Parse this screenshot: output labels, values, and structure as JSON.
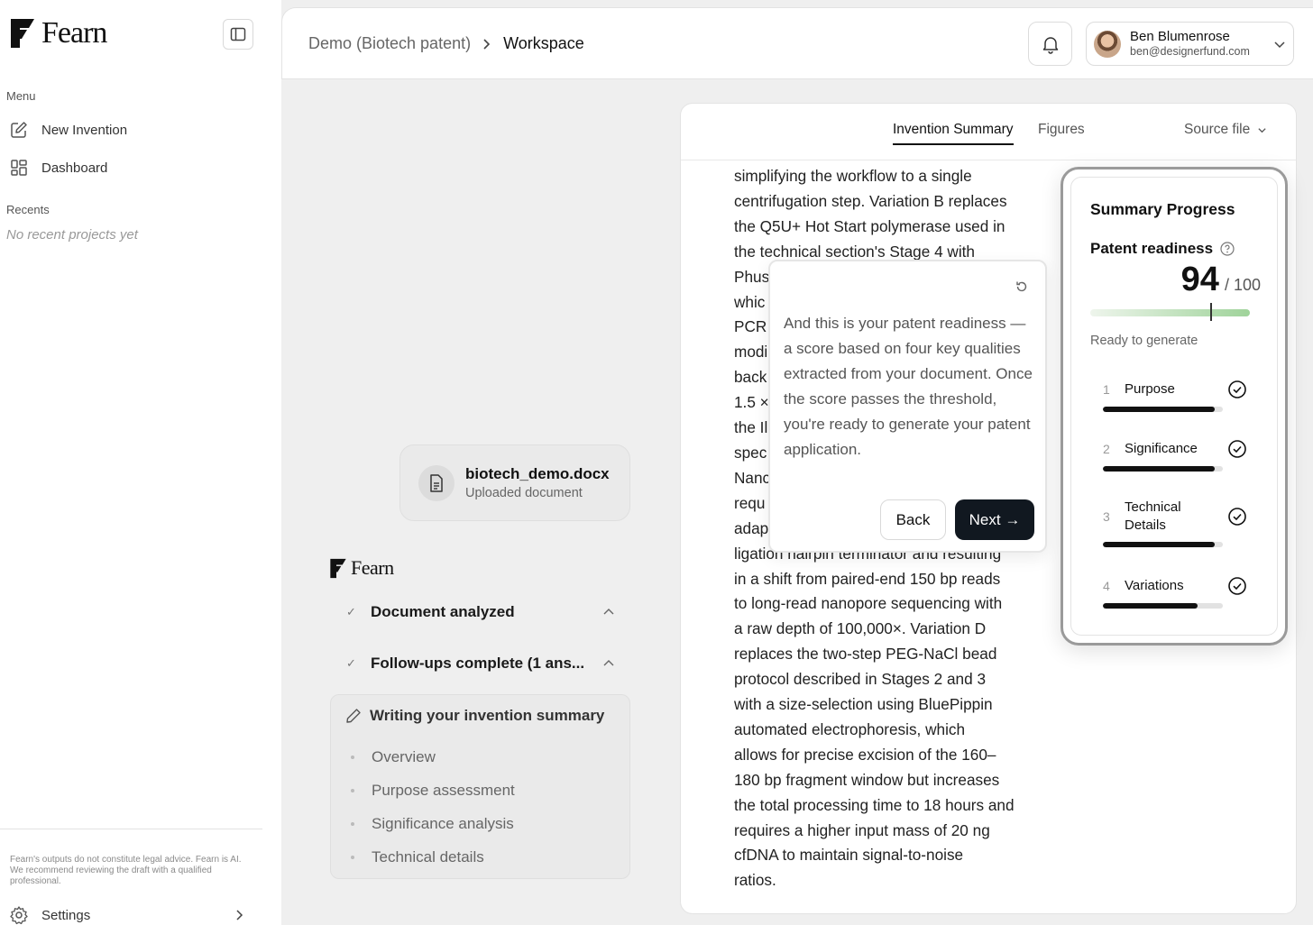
{
  "app": {
    "brand": "Fearn"
  },
  "sidebar": {
    "menu_label": "Menu",
    "items": [
      {
        "label": "New Invention",
        "icon": "edit-icon"
      },
      {
        "label": "Dashboard",
        "icon": "grid-icon"
      }
    ],
    "recents_label": "Recents",
    "recents_empty": "No recent projects yet",
    "disclaimer": "Fearn's outputs do not constitute legal advice. Fearn is AI. We recommend reviewing the draft with a qualified professional.",
    "settings_label": "Settings"
  },
  "header": {
    "breadcrumb": [
      "Demo (Biotech patent)",
      "Workspace"
    ],
    "user": {
      "name": "Ben Blumenrose",
      "email": "ben@designerfund.com"
    }
  },
  "upload": {
    "file_name": "biotech_demo.docx",
    "file_sub": "Uploaded document"
  },
  "steps": {
    "analyzed": "Document analyzed",
    "followups": "Follow-ups complete (1 ans...",
    "writing": "Writing your invention summary",
    "sub_steps": [
      "Overview",
      "Purpose assessment",
      "Significance analysis",
      "Technical details"
    ]
  },
  "doc": {
    "tabs": [
      "Invention Summary",
      "Figures"
    ],
    "source_file": "Source file",
    "lines": [
      "simplifying the workflow to a single",
      "centrifugation step. Variation B replaces",
      "the Q5U+ Hot Start polymerase used in",
      "the technical section's Stage 4 with",
      "Phus",
      "whic",
      "PCR",
      "modi",
      "back",
      "1.5 ×",
      "the Il",
      "spec",
      "Nanc",
      "requ",
      "adap",
      "ligation hairpin terminator and resulting",
      "in a shift from paired-end 150 bp reads",
      "to long-read nanopore sequencing with",
      "a raw depth of 100,000×. Variation D",
      "replaces the two-step PEG-NaCl bead",
      "protocol described in Stages 2 and 3",
      "with a size-selection using BluePippin",
      "automated electrophoresis, which",
      "allows for precise excision of the 160–",
      "180 bp fragment window but increases",
      "the total processing time to 18 hours and",
      "requires a higher input mass of 20 ng",
      "cfDNA to maintain signal-to-noise",
      "ratios."
    ]
  },
  "tour": {
    "text": "And this is your patent readiness — a score based on four key qualities extracted from your document. Once the score passes the threshold, you're ready to generate your patent application.",
    "back": "Back",
    "next": "Next →"
  },
  "progress": {
    "title": "Summary Progress",
    "readiness_label": "Patent readiness",
    "score": "94",
    "score_max": "/ 100",
    "score_fraction": 0.94,
    "threshold_fraction": 0.71,
    "status": "Ready to generate",
    "criteria": [
      {
        "num": "1",
        "label": "Purpose",
        "fill": 0.93
      },
      {
        "num": "2",
        "label": "Significance",
        "fill": 0.93
      },
      {
        "num": "3",
        "label": "Technical Details",
        "fill": 0.93
      },
      {
        "num": "4",
        "label": "Variations",
        "fill": 0.79
      }
    ]
  }
}
